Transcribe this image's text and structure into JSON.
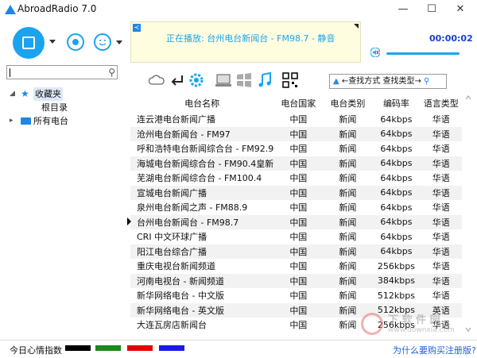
{
  "window": {
    "title": "AbroadRadio 7.0",
    "min_glyph": "—",
    "max_glyph": "☐",
    "close_glyph": "✕"
  },
  "nowplaying": {
    "text": "正在播放:   台州电台新闻台 - FM98.7 - 静音",
    "time": "00:00:02",
    "share_glyph": "≺"
  },
  "volume": {
    "level": 1.0
  },
  "search": {
    "value": "",
    "placeholder": ""
  },
  "tree": {
    "favorites": "收藏夹",
    "root": "根目录",
    "all": "所有电台"
  },
  "toolbar": {
    "find_text": "←查找方式  查找类型→"
  },
  "table": {
    "headers": [
      "电台名称",
      "电台国家",
      "电台类别",
      "编码率",
      "语言类型"
    ],
    "rows": [
      [
        "连云港电台新闻广播",
        "中国",
        "新闻",
        "64kbps",
        "华语"
      ],
      [
        "沧州电台新闻台 - FM97",
        "中国",
        "新闻",
        "64kbps",
        "华语"
      ],
      [
        "呼和浩特电台新闻综合台 - FM92.9",
        "中国",
        "新闻",
        "64kbps",
        "华语"
      ],
      [
        "海城电台新闻综合台 - FM90.4皇新",
        "中国",
        "新闻",
        "64kbps",
        "华语"
      ],
      [
        "芜湖电台新闻综合台 - FM100.4",
        "中国",
        "新闻",
        "64kbps",
        "华语"
      ],
      [
        "宣城电台新闻广播",
        "中国",
        "新闻",
        "64kbps",
        "华语"
      ],
      [
        "泉州电台新闻之声 - FM88.9",
        "中国",
        "新闻",
        "64kbps",
        "华语"
      ],
      [
        "台州电台新闻台 - FM98.7",
        "中国",
        "新闻",
        "64kbps",
        "华语"
      ],
      [
        "CRI 中文环球广播",
        "中国",
        "新闻",
        "64kbps",
        "华语"
      ],
      [
        "阳江电台综合广播",
        "中国",
        "新闻",
        "64kbps",
        "华语"
      ],
      [
        "重庆电视台新闻频道",
        "中国",
        "新闻",
        "256kbps",
        "华语"
      ],
      [
        "河南电视台 - 新闻频道",
        "中国",
        "新闻",
        "384kbps",
        "华语"
      ],
      [
        "新华网络电台 - 中文版",
        "中国",
        "新闻",
        "512kbps",
        "华语"
      ],
      [
        "新华网络电台 - 英文版",
        "中国",
        "新闻",
        "512kbps",
        "英语"
      ],
      [
        "大连瓦房店新闻台",
        "中国",
        "新闻",
        "256kbps",
        "华语"
      ]
    ]
  },
  "status": {
    "mood_label": "今日心情指数",
    "swatches": [
      "#000000",
      "#1a8a1a",
      "#e60000",
      "#1a1aee"
    ],
    "register_link": "为什么要购买注册版?"
  },
  "watermark": {
    "text": "下 软 件 园",
    "url": "www.downxia.com"
  },
  "colors": {
    "accent": "#1aa3f0",
    "time": "#1a3fd6",
    "link": "#1e5fd6"
  }
}
